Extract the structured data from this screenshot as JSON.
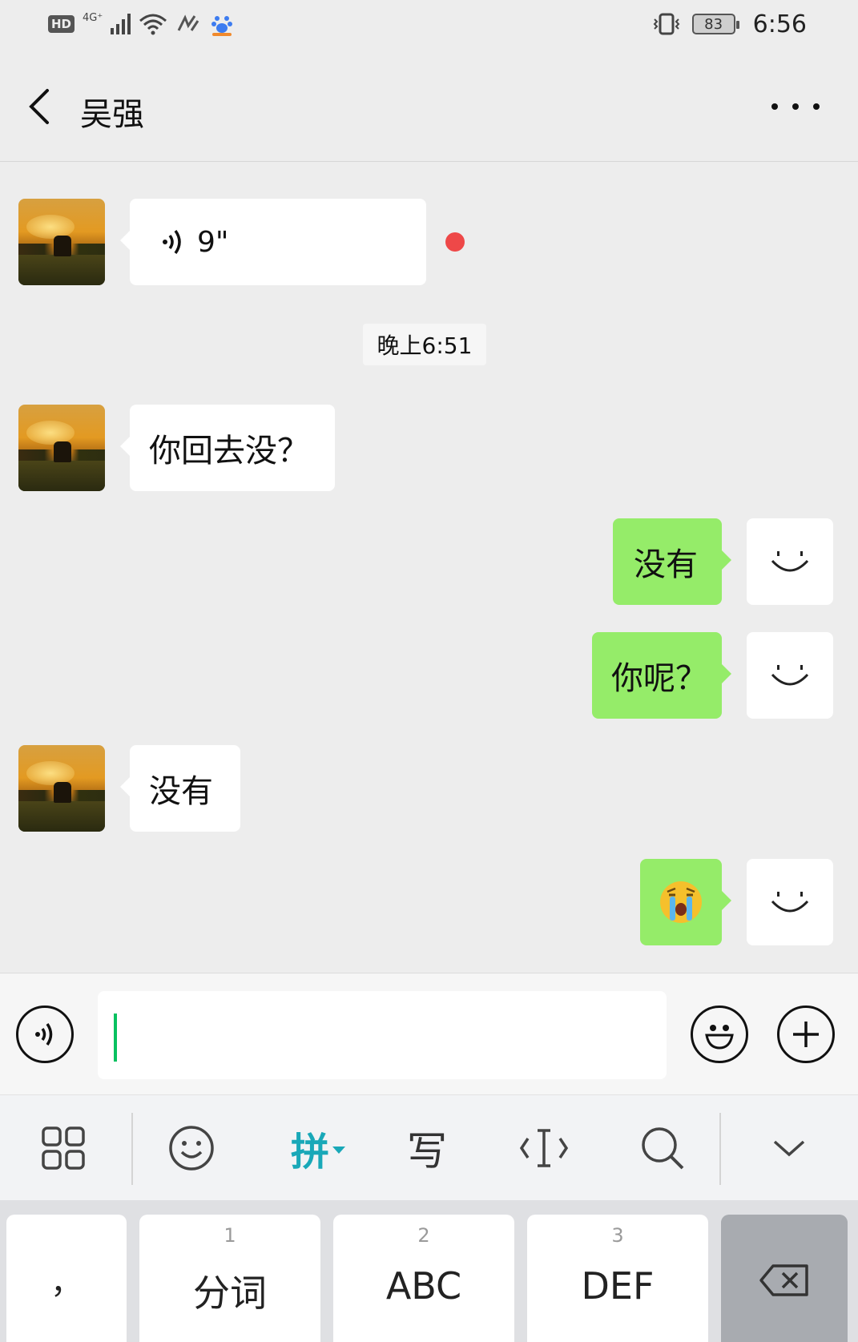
{
  "status_bar": {
    "hd": "HD",
    "network": "4G⁺",
    "battery": "83",
    "time": "6:56"
  },
  "nav": {
    "title": "吴强"
  },
  "messages": {
    "voice_duration": "9\"",
    "timestamp": "晚上6:51",
    "m1": "你回去没？",
    "m2": "没有",
    "m3": "你呢？",
    "m4": "没有",
    "m5_emoji": "😭"
  },
  "keyboard_toolbar": {
    "pinyin": "拼",
    "write": "写"
  },
  "keyboard": {
    "punct": "，",
    "key1_num": "1",
    "key1_label": "分词",
    "key2_num": "2",
    "key2_label": "ABC",
    "key3_num": "3",
    "key3_label": "DEF"
  },
  "colors": {
    "outgoing_bubble": "#95ec69",
    "incoming_bubble": "#ffffff",
    "background": "#ededed",
    "unread_dot": "#ee4848",
    "pinyin_accent": "#19a8b8",
    "caret": "#07c160"
  }
}
